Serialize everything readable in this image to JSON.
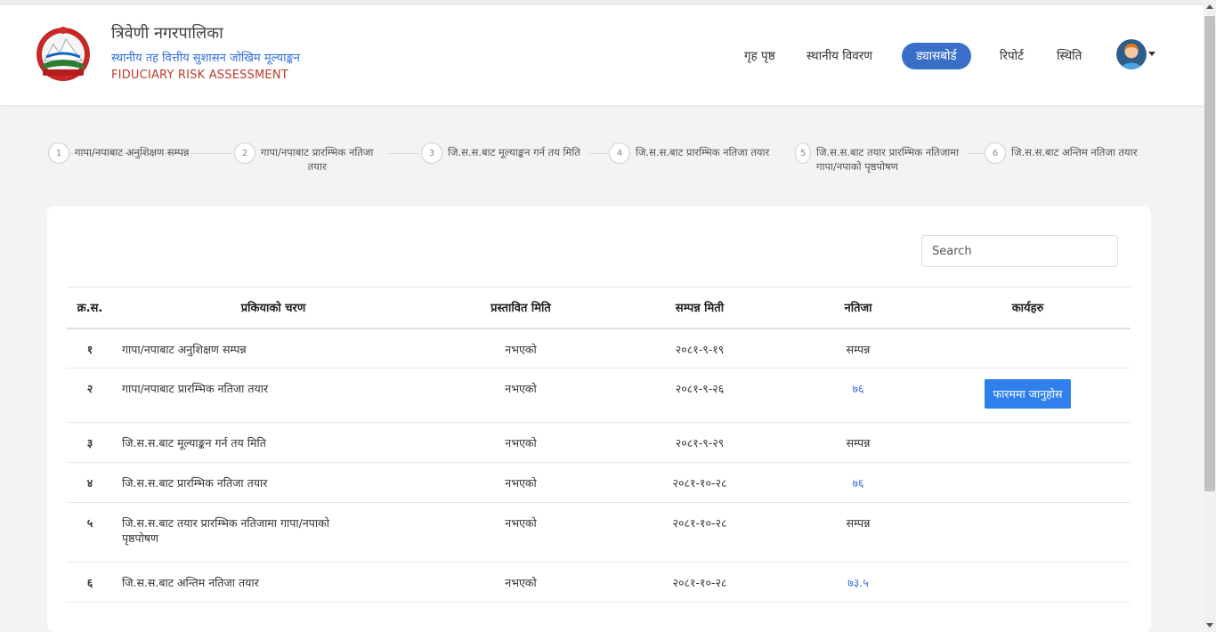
{
  "header": {
    "title": "त्रिवेणी नगरपालिका",
    "subtitle": "स्थानीय तह वित्तीय सुशासन जोखिम मूल्याङ्कन",
    "subtitle_en": "FIDUCIARY RISK ASSESSMENT",
    "logo_icon": "nepal-emblem-logo"
  },
  "nav": {
    "items": [
      "गृह पृष्ठ",
      "स्थानीय विवरण",
      "ड्यासबोर्ड",
      "रिपोर्ट",
      "स्थिति"
    ],
    "active": "ड्यासबोर्ड",
    "accent": "#3a6fc9"
  },
  "steps": [
    {
      "num": "1",
      "line1": "गापा/नपाबाट अनुशिक्षण सम्पन्न",
      "line2": ""
    },
    {
      "num": "2",
      "line1": "गापा/नपाबाट प्रारम्भिक नतिजा",
      "line2": "तयार"
    },
    {
      "num": "3",
      "line1": "जि.स.स.बाट मूल्याङ्कन गर्न तय मिति",
      "line2": ""
    },
    {
      "num": "4",
      "line1": "जि.स.स.बाट प्रारम्भिक नतिजा तयार",
      "line2": ""
    },
    {
      "num": "5",
      "line1": "जि.स.स.बाट तयार प्रारम्भिक नतिजामा",
      "line2": "गापा/नपाको पृष्ठपोषण"
    },
    {
      "num": "6",
      "line1": "जि.स.स.बाट अन्तिम नतिजा तयार",
      "line2": ""
    }
  ],
  "search": {
    "placeholder": "Search"
  },
  "table": {
    "headers": [
      "क्र.स.",
      "प्रकियाको चरण",
      "प्रस्तावित मिति",
      "सम्पन्न मिती",
      "नतिजा",
      "कार्यहरु"
    ],
    "rows": [
      {
        "sn": "१",
        "step": "गापा/नपाबाट अनुशिक्षण सम्पन्न",
        "step2": "",
        "proposed": "नभएको",
        "completed": "२०८१-९-१९",
        "result": "सम्पन्न",
        "action": ""
      },
      {
        "sn": "२",
        "step": "गापा/नपाबाट प्रारम्भिक नतिजा तयार",
        "step2": "",
        "proposed": "नभएको",
        "completed": "२०८१-९-२६",
        "result": "७६",
        "action": "फारममा जानुहोस"
      },
      {
        "sn": "३",
        "step": "जि.स.स.बाट मूल्याङ्कन गर्न तय मिति",
        "step2": "",
        "proposed": "नभएको",
        "completed": "२०८१-९-२९",
        "result": "सम्पन्न",
        "action": ""
      },
      {
        "sn": "४",
        "step": "जि.स.स.बाट प्रारम्भिक नतिजा तयार",
        "step2": "",
        "proposed": "नभएको",
        "completed": "२०८१-१०-२८",
        "result": "७६",
        "action": ""
      },
      {
        "sn": "५",
        "step": "जि.स.स.बाट तयार प्रारम्भिक नतिजामा गापा/नपाको",
        "step2": "पृष्ठपोषण",
        "proposed": "नभएको",
        "completed": "२०८१-१०-२८",
        "result": "सम्पन्न",
        "action": ""
      },
      {
        "sn": "६",
        "step": "जि.स.स.बाट अन्तिम नतिजा तयार",
        "step2": "",
        "proposed": "नभएको",
        "completed": "२०८१-१०-२८",
        "result": "७३.५",
        "action": ""
      }
    ]
  },
  "colors": {
    "link": "#3a6fe0",
    "button": "#2f80ed",
    "brand_sub": "#2f6fd6",
    "brand_en": "#c0392b"
  }
}
